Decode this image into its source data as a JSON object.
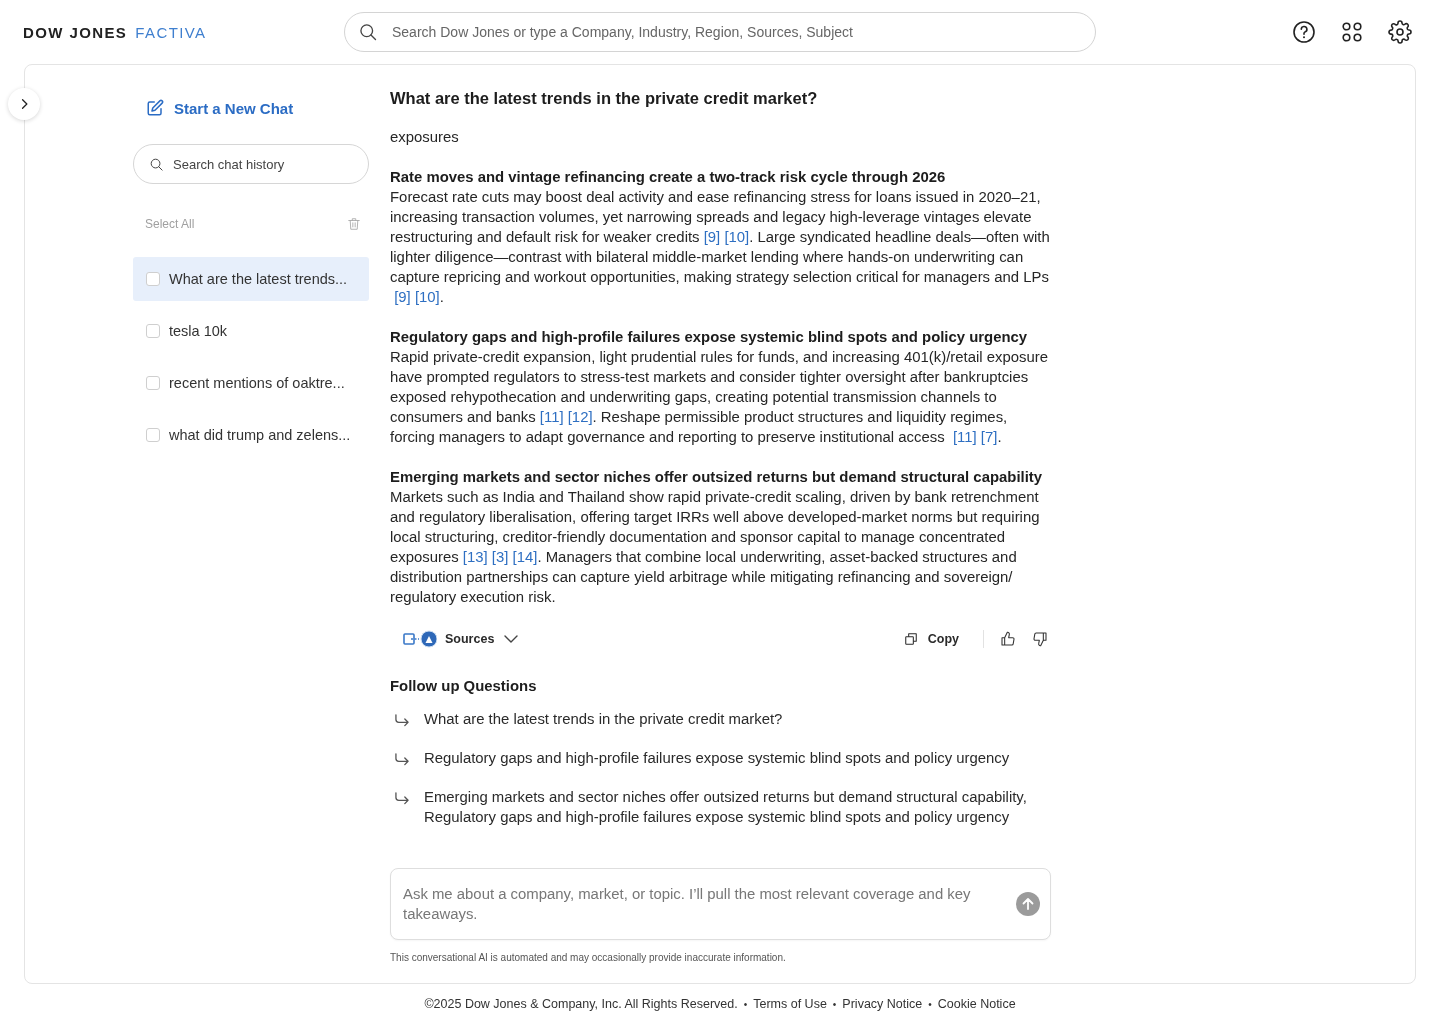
{
  "header": {
    "logo": {
      "brand": "DOW JONES",
      "product": "FACTIVA"
    },
    "search": {
      "placeholder": "Search Dow Jones or type a Company, Industry, Region, Sources, Subject"
    }
  },
  "sidebar": {
    "new_chat": "Start a New Chat",
    "search": {
      "placeholder": "Search chat history"
    },
    "select_all": {
      "label": "Select All",
      "disabled": true
    },
    "delete": {
      "disabled": true
    },
    "history": [
      {
        "title": "What are the latest trends...",
        "selected": true,
        "checked": false
      },
      {
        "title": "tesla 10k",
        "selected": false,
        "checked": false
      },
      {
        "title": "recent mentions of oaktre...",
        "selected": false,
        "checked": false
      },
      {
        "title": "what did trump and zelens...",
        "selected": false,
        "checked": false
      }
    ]
  },
  "conversation": {
    "question": "What are the latest trends in the private credit market?",
    "intro": "exposures",
    "sections": [
      {
        "heading": "Rate moves and vintage refinancing create a two-track risk cycle through 2026",
        "body": [
          {
            "kind": "text",
            "text": "Forecast rate cuts may boost deal activity and ease refinancing stress for loans issued in 2020–21, increasing transaction volumes, yet narrowing spreads and legacy high-leverage vintages elevate restructuring and default risk for weaker credits "
          },
          {
            "kind": "citation",
            "text": "[9]"
          },
          {
            "kind": "citation",
            "text": "[10]"
          },
          {
            "kind": "text",
            "text": ". Large syndicated headline deals—often with lighter diligence—contrast with bilateral middle-market lending where hands-on underwriting can capture repricing and workout opportunities, making strategy selection critical for managers and LPs "
          },
          {
            "kind": "citation",
            "text": "[9]"
          },
          {
            "kind": "citation",
            "text": "[10]"
          },
          {
            "kind": "text",
            "text": "."
          }
        ]
      },
      {
        "heading": "Regulatory gaps and high-profile failures expose systemic blind spots and policy urgency",
        "body": [
          {
            "kind": "text",
            "text": "Rapid private-credit expansion, light prudential rules for funds, and increasing 401(k)/retail exposure have prompted regulators to stress-test markets and consider tighter oversight after bankruptcies exposed rehypothecation and underwriting gaps, creating potential transmission channels to consumers and banks "
          },
          {
            "kind": "citation",
            "text": "[11]"
          },
          {
            "kind": "citation",
            "text": "[12]"
          },
          {
            "kind": "text",
            "text": ". Reshape permissible product structures and liquidity regimes, forcing managers to adapt governance and reporting to preserve institutional access "
          },
          {
            "kind": "citation",
            "text": "[11]"
          },
          {
            "kind": "citation",
            "text": "[7]"
          },
          {
            "kind": "text",
            "text": "."
          }
        ]
      },
      {
        "heading": "Emerging markets and sector niches offer outsized returns but demand structural capability",
        "body": [
          {
            "kind": "text",
            "text": "Markets such as India and Thailand show rapid private-credit scaling, driven by bank retrenchment and regulatory liberalisation, offering target IRRs well above developed-market norms but requiring local structuring, creditor-friendly documentation and sponsor capital to manage concentrated exposures "
          },
          {
            "kind": "citation",
            "text": "[13]"
          },
          {
            "kind": "citation",
            "text": "[3]"
          },
          {
            "kind": "citation",
            "text": "[14]"
          },
          {
            "kind": "text",
            "text": ". Managers that combine local underwriting, asset-backed structures and distribution partnerships can capture yield arbitrage while mitigating refinancing and sovereign/ regulatory execution risk."
          }
        ]
      }
    ],
    "actions": {
      "sources": "Sources",
      "copy": "Copy"
    },
    "follow_up": {
      "title": "Follow up Questions",
      "questions": [
        "What are the latest trends in the private credit market?",
        "Regulatory gaps and high-profile failures expose systemic blind spots and policy urgency",
        "Emerging markets and sector niches offer outsized returns but demand structural capability, Regulatory gaps and high-profile failures expose systemic blind spots and policy urgency"
      ]
    }
  },
  "composer": {
    "placeholder": "Ask me about a company, market, or topic. I’ll pull the most relevant coverage and key takeaways.",
    "send_disabled": true,
    "disclaimer": "This conversational AI is automated and may occasionally provide inaccurate information."
  },
  "footer": [
    {
      "kind": "text",
      "text": "©2025 Dow Jones & Company, Inc. All Rights Reserved."
    },
    {
      "kind": "separator",
      "text": "•"
    },
    {
      "kind": "link",
      "text": "Terms of Use"
    },
    {
      "kind": "separator",
      "text": "•"
    },
    {
      "kind": "link",
      "text": "Privacy Notice"
    },
    {
      "kind": "separator",
      "text": "•"
    },
    {
      "kind": "link",
      "text": "Cookie Notice"
    }
  ]
}
